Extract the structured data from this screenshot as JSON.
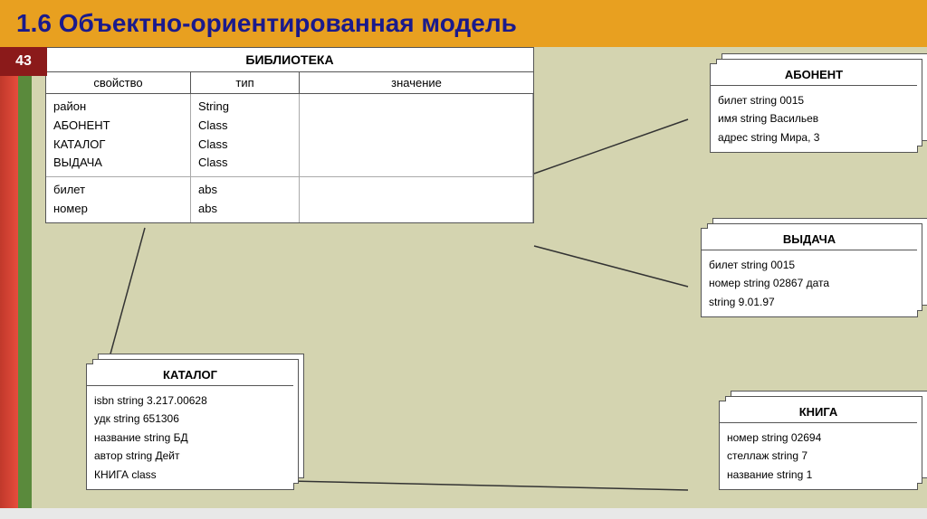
{
  "header": {
    "title": "1.6 Объектно-ориентированная модель"
  },
  "page_number": "43",
  "main_table": {
    "title": "БИБЛИОТЕКА",
    "columns": [
      "свойство",
      "тип",
      "значение"
    ],
    "rows_group1": [
      {
        "property": "район",
        "type": "String",
        "value": ""
      },
      {
        "property": "АБОНЕНТ",
        "type": "Class",
        "value": ""
      },
      {
        "property": "КАТАЛОГ",
        "type": "Class",
        "value": ""
      },
      {
        "property": "ВЫДАЧА",
        "type": "Class",
        "value": ""
      }
    ],
    "rows_group2": [
      {
        "property": "билет",
        "type": "abs",
        "value": ""
      },
      {
        "property": "номер",
        "type": "abs",
        "value": ""
      }
    ]
  },
  "abonent_box": {
    "title": "АБОНЕНТ",
    "rows": [
      "билет  string  0015",
      "имя    string  Васильев",
      "адрес  string  Мира, 3"
    ]
  },
  "vydacha_box": {
    "title": "ВЫДАЧА",
    "rows": [
      "билет  string  0015",
      "номер  string  02867  дата",
      "string  9.01.97"
    ]
  },
  "katalog_box": {
    "title": "КАТАЛОГ",
    "rows": [
      "isbn      string  3.217.00628",
      "удк      string  651306",
      "название  string  БД",
      "автор    string  Дейт",
      "КНИГА    class"
    ]
  },
  "kniga_box": {
    "title": "КНИГА",
    "rows": [
      "номер      string  02694",
      "стеллаж  string  7",
      "название  string  1"
    ]
  }
}
